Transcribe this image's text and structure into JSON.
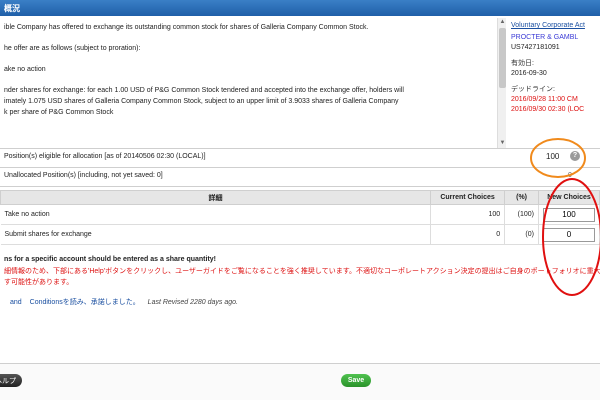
{
  "titlebar": {
    "title": "概況"
  },
  "description": {
    "line1": "ible Company has offered to exchange its outstanding common stock for shares of Galleria Company Common Stock.",
    "line2": "he offer are as follows (subject to proration):",
    "line3": "ake no action",
    "line4a": "nder shares for exchange: for each 1.00 USD of P&G Common Stock tendered and accepted into the exchange offer, holders will",
    "line4b": "imately 1.075 USD shares of Galleria Company Common Stock, subject to an upper limit of 3.9033 shares of Galleria Company",
    "line4c": "k per share of P&G Common Stock"
  },
  "side": {
    "link": "Voluntary Corporate Act",
    "company": "PROCTER & GAMBL",
    "code": "US7427181091",
    "date_label": "有効日:",
    "date_value": "2016-09-30",
    "deadline_label": "デッドライン:",
    "deadline_1": "2016/09/28 11:00 CM",
    "deadline_2": "2016/09/30 02:30 (LOC"
  },
  "positions": {
    "eligible_label": "Position(s) eligible for allocation [as of 20140506 02:30 (LOCAL)]",
    "eligible_value": "100",
    "unallocated_label": "Unallocated Position(s) [including, not yet saved: 0]",
    "unallocated_value": "0"
  },
  "table": {
    "headers": {
      "detail": "詳細",
      "current": "Current Choices",
      "pct": "(%)",
      "new": "New Choices"
    },
    "rows": [
      {
        "label": "Take no action",
        "current": "100",
        "pct": "(100)",
        "new": "100"
      },
      {
        "label": "Submit shares for exchange",
        "current": "0",
        "pct": "(0)",
        "new": "0"
      }
    ]
  },
  "warning": "ns for a specific account should be entered as a share quantity!",
  "japanese": {
    "line1": "細情報のため、下部にある'Help'ボタンをクリックし、ユーザーガイドをご覧になることを強く推奨しています。不適切なコーポレートアクション決定の提出はご自身のポートフォリオに重大影響を",
    "line2": "す可能性があります。"
  },
  "terms": {
    "and": "and",
    "conditions": "Conditionsを読み、承諾しました。",
    "revised": "Last Revised 2280 days ago."
  },
  "footer": {
    "help": "ヘルプ",
    "save": "Save"
  },
  "colors": {
    "titlebar": "#1f5fa8",
    "annotation": "#e01010",
    "highlight": "#f08a1c",
    "save": "#2a922a"
  }
}
